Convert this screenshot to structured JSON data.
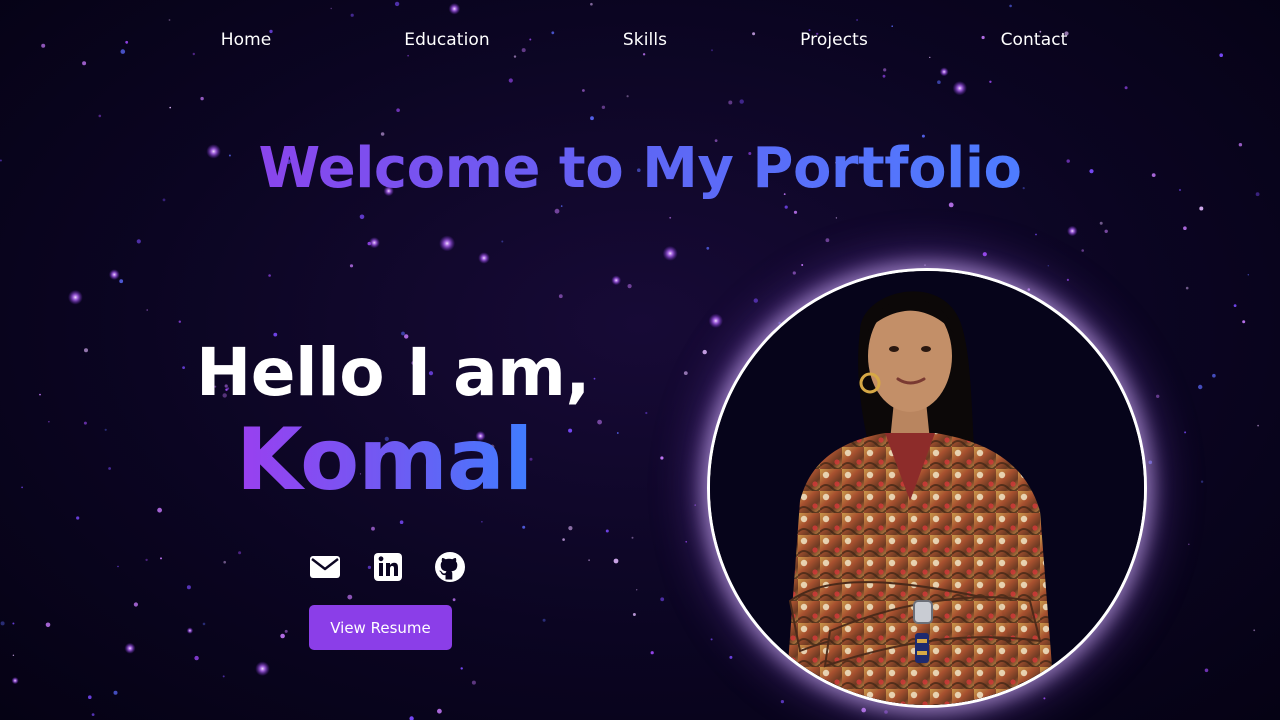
{
  "nav": {
    "items": [
      {
        "label": "Home"
      },
      {
        "label": "Education"
      },
      {
        "label": "Skills"
      },
      {
        "label": "Projects"
      },
      {
        "label": "Contact"
      }
    ]
  },
  "hero": {
    "title": "Welcome to My Portfolio",
    "greeting": "Hello I am,",
    "name": "Komal"
  },
  "socials": [
    {
      "icon": "envelope-icon"
    },
    {
      "icon": "linkedin-icon"
    },
    {
      "icon": "github-icon"
    }
  ],
  "actions": {
    "resume_label": "View Resume"
  },
  "profile": {
    "image": "profile-photo"
  },
  "colors": {
    "background": "#07031a",
    "accent_purple": "#8b3ee8",
    "accent_blue": "#4e7cff",
    "star": "#c47bff"
  }
}
